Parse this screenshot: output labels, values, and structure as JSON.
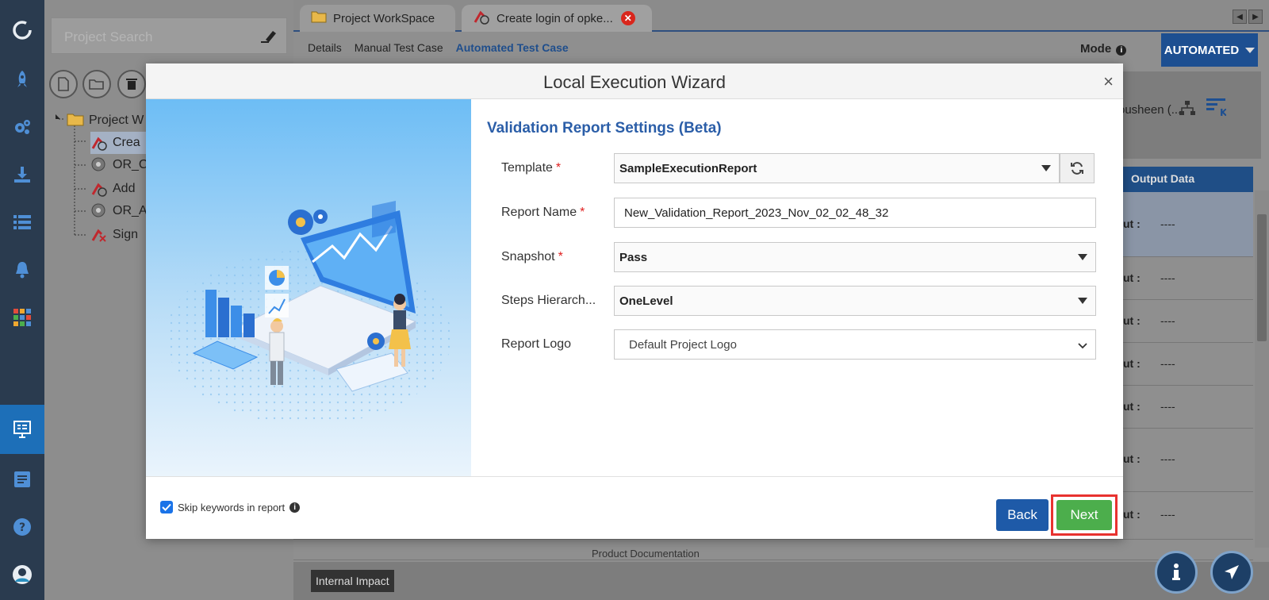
{
  "tabs": {
    "workspace": "Project WorkSpace",
    "testcase": "Create login of opke..."
  },
  "subtabs": {
    "details": "Details",
    "manual": "Manual Test Case",
    "automated": "Automated Test Case"
  },
  "mode": {
    "label": "Mode",
    "value": "AUTOMATED"
  },
  "owner_text": "ousheen (...",
  "grid": {
    "output_header": "Output Data",
    "out_label": "ut :",
    "dash": "----",
    "partial_text": "Product Documentation"
  },
  "search": {
    "placeholder": "Project Search"
  },
  "tree": {
    "root": "Project W",
    "items": [
      "Crea",
      "OR_C",
      "Add",
      "OR_A",
      "Sign"
    ]
  },
  "bottom": {
    "impact": "Internal Impact"
  },
  "modal": {
    "title": "Local Execution Wizard",
    "section": "Validation Report Settings (Beta)",
    "fields": {
      "template": {
        "label": "Template",
        "value": "SampleExecutionReport"
      },
      "report_name": {
        "label": "Report Name",
        "value": "New_Validation_Report_2023_Nov_02_02_48_32"
      },
      "snapshot": {
        "label": "Snapshot",
        "value": "Pass"
      },
      "steps": {
        "label": "Steps Hierarch...",
        "value": "OneLevel"
      },
      "logo": {
        "label": "Report Logo",
        "value": "Default Project Logo"
      }
    },
    "required_mark": "*",
    "skip_label": "Skip keywords in report",
    "back": "Back",
    "next": "Next"
  },
  "colors": {
    "primary": "#1e5aa8",
    "success": "#4cae4c",
    "highlight": "#e8322f",
    "section": "#2b5ea8"
  }
}
